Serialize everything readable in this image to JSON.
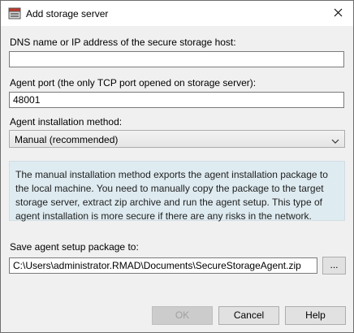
{
  "window": {
    "title": "Add storage server"
  },
  "dns": {
    "label": "DNS name or IP address of the secure storage host:",
    "value": ""
  },
  "port": {
    "label": "Agent port (the only TCP port opened on storage server):",
    "value": "48001"
  },
  "install_method": {
    "label": "Agent installation method:",
    "selected": "Manual (recommended)"
  },
  "info": {
    "text": "The manual installation method exports the agent installation package to the local machine. You need to manually copy the package to the target storage server, extract zip archive and run the agent setup. This type of agent installation is more secure if there are any risks in the network."
  },
  "save_path": {
    "label": "Save agent setup package to:",
    "value": "C:\\Users\\administrator.RMAD\\Documents\\SecureStorageAgent.zip",
    "browse_label": "..."
  },
  "buttons": {
    "ok": "OK",
    "cancel": "Cancel",
    "help": "Help"
  },
  "icons": {
    "app": "server-icon",
    "close": "close-icon",
    "dropdown": "chevron-down-icon"
  }
}
